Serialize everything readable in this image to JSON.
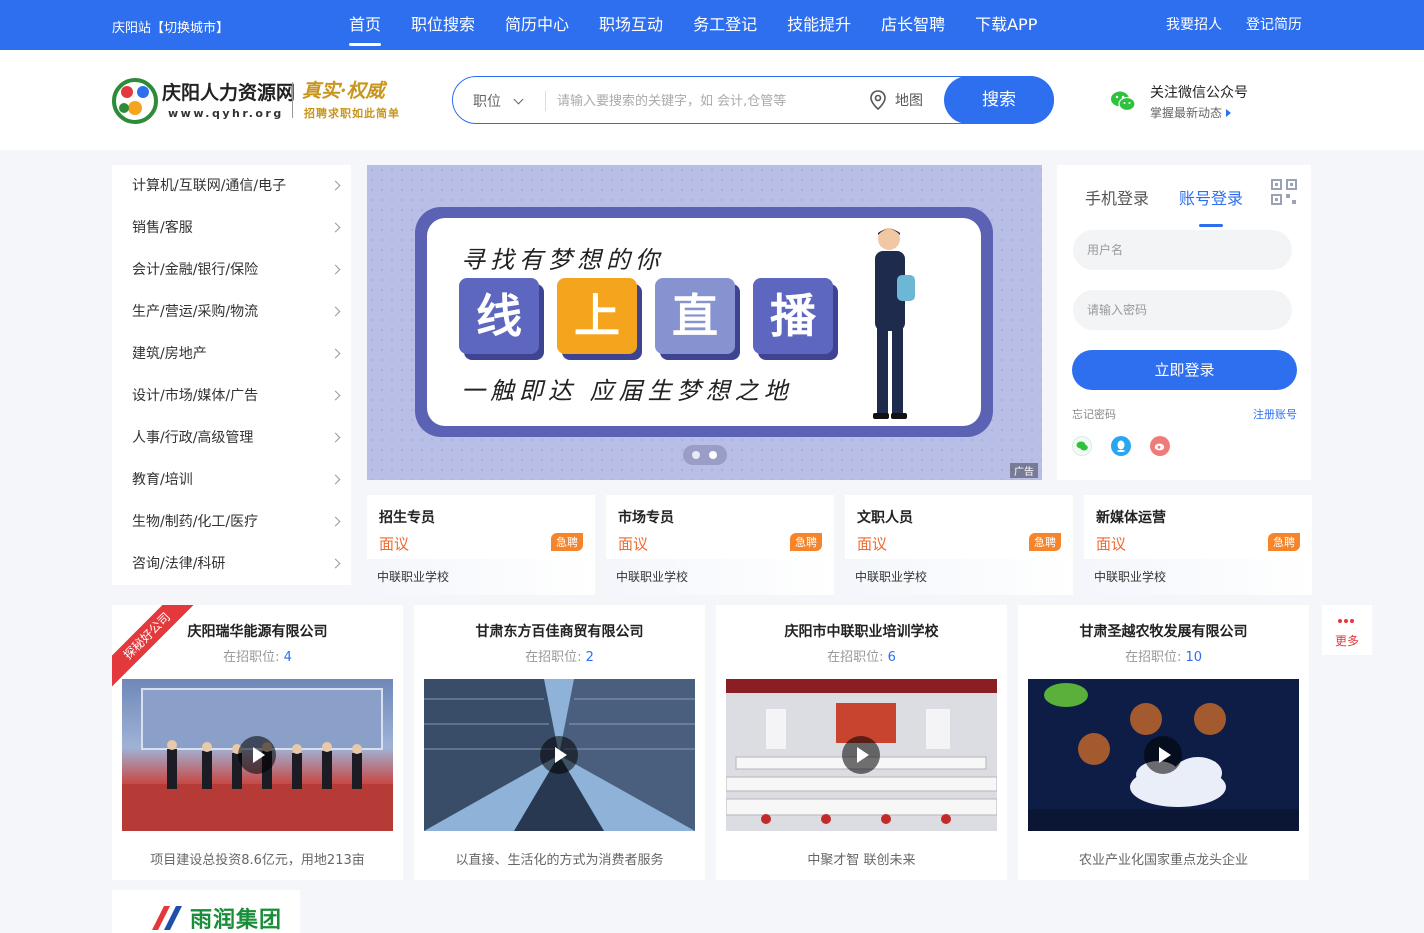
{
  "topbar": {
    "city": "庆阳站【切换城市】",
    "nav": [
      "首页",
      "职位搜索",
      "简历中心",
      "职场互动",
      "务工登记",
      "技能提升",
      "店长智聘",
      "下载APP"
    ],
    "right": [
      "我要招人",
      "登记简历"
    ]
  },
  "header": {
    "logo_name": "庆阳人力资源网",
    "logo_url": "www.qyhr.org",
    "slogan": "真实·权威",
    "slogan2": "招聘求职如此简单",
    "search": {
      "type": "职位",
      "placeholder": "请输入要搜索的关键字，如 会计,仓管等",
      "map": "地图",
      "button": "搜索"
    },
    "wechat": {
      "title": "关注微信公众号",
      "subtitle": "掌握最新动态"
    }
  },
  "categories": [
    "计算机/互联网/通信/电子",
    "销售/客服",
    "会计/金融/银行/保险",
    "生产/营运/采购/物流",
    "建筑/房地产",
    "设计/市场/媒体/广告",
    "人事/行政/高级管理",
    "教育/培训",
    "生物/制药/化工/医疗",
    "咨询/法律/科研"
  ],
  "banner": {
    "headline": "寻找有梦想的你",
    "tiles": [
      "线",
      "上",
      "直",
      "播"
    ],
    "subline": "一触即达 应届生梦想之地",
    "ad_label": "广告"
  },
  "login": {
    "tabs": [
      "手机登录",
      "账号登录"
    ],
    "username_placeholder": "用户名",
    "password_placeholder": "请输入密码",
    "submit": "立即登录",
    "forgot": "忘记密码",
    "register": "注册账号"
  },
  "jobs": [
    {
      "title": "招生专员",
      "salary": "面议",
      "badge": "急聘",
      "company": "中联职业学校"
    },
    {
      "title": "市场专员",
      "salary": "面议",
      "badge": "急聘",
      "company": "中联职业学校"
    },
    {
      "title": "文职人员",
      "salary": "面议",
      "badge": "急聘",
      "company": "中联职业学校"
    },
    {
      "title": "新媒体运营",
      "salary": "面议",
      "badge": "急聘",
      "company": "中联职业学校"
    }
  ],
  "companies": [
    {
      "name": "庆阳瑞华能源有限公司",
      "count_label": "在招职位:",
      "count": "4",
      "desc": "项目建设总投资8.6亿元，用地213亩",
      "ribbon": "探秘好公司"
    },
    {
      "name": "甘肃东方百佳商贸有限公司",
      "count_label": "在招职位:",
      "count": "2",
      "desc": "以直接、生活化的方式为消费者服务"
    },
    {
      "name": "庆阳市中联职业培训学校",
      "count_label": "在招职位:",
      "count": "6",
      "desc": "中聚才智 联创未来"
    },
    {
      "name": "甘肃圣越农牧发展有限公司",
      "count_label": "在招职位:",
      "count": "10",
      "desc": "农业产业化国家重点龙头企业"
    }
  ],
  "more_label": "更多",
  "brand_logo_text": "雨润集团",
  "colors": {
    "primary": "#2e6ff0",
    "accent": "#f06a2f",
    "badge": "#f5842b",
    "ribbon": "#e4393c"
  }
}
